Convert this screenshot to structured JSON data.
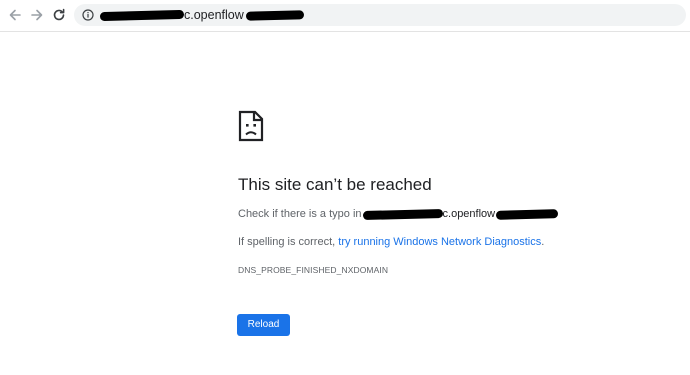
{
  "toolbar": {
    "back_icon": "arrow-left-icon",
    "forward_icon": "arrow-right-icon",
    "reload_icon": "reload-icon",
    "info_icon": "info-circle-icon",
    "url_visible_fragment_1": "c.openflow",
    "redacted": true
  },
  "error_page": {
    "icon": "sad-document-icon",
    "title": "This site can’t be reached",
    "typo_prefix": "Check if there is a typo in",
    "typo_domain_fragment": "c.openflow",
    "spelling_prefix": "If spelling is correct, ",
    "diagnostics_link": "try running Windows Network Diagnostics",
    "spelling_suffix": ".",
    "error_code": "DNS_PROBE_FINISHED_NXDOMAIN",
    "reload_button": "Reload"
  },
  "colors": {
    "link": "#1a73e8",
    "button_bg": "#1a73e8",
    "button_text": "#ffffff",
    "title": "#202124",
    "body_text": "#5f6368",
    "omnibox_bg": "#f1f3f4"
  }
}
